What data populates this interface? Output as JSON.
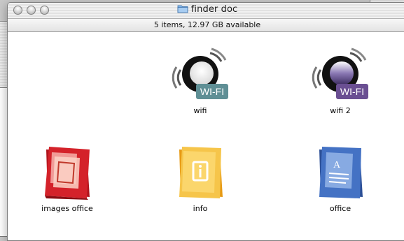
{
  "window": {
    "title": "finder doc",
    "status": "5 items, 12.97 GB available"
  },
  "items": [
    {
      "label": "wifi",
      "badge": "WI-FI",
      "icon": "wifi-icon"
    },
    {
      "label": "wifi 2",
      "badge": "WI-FI",
      "icon": "wifi-purple-icon"
    },
    {
      "label": "images office",
      "icon": "images-office-folder-icon"
    },
    {
      "label": "info",
      "icon": "info-folder-icon"
    },
    {
      "label": "office",
      "icon": "office-folder-icon"
    }
  ],
  "colors": {
    "wifi_badge": "#5f8f95",
    "wifi2_badge": "#6a4f92",
    "images_office": "#d4222a",
    "info": "#f3b21c",
    "office": "#3f67b8"
  }
}
